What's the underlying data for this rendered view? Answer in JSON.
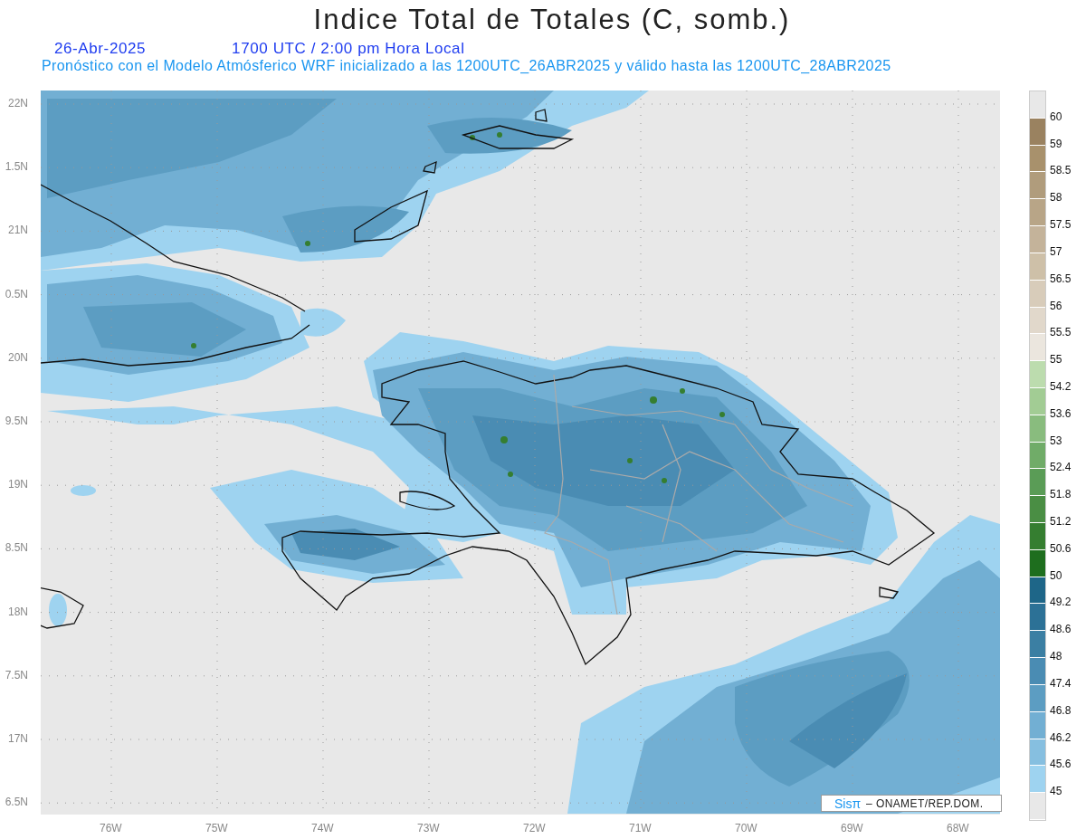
{
  "title": "Indice Total de Totales (C, somb.)",
  "date": "26-Abr-2025",
  "time": "1700 UTC / 2:00 pm Hora Local",
  "subtitle": "Pronóstico con el Modelo Atmósferico WRF inicializado a las 1200UTC_26ABR2025 y válido hasta las  1200UTC_28ABR2025",
  "map": {
    "lat_labels": [
      "22N",
      "1.5N",
      "21N",
      "0.5N",
      "20N",
      "9.5N",
      "19N",
      "8.5N",
      "18N",
      "7.5N",
      "17N",
      "6.5N"
    ],
    "lon_labels": [
      "76W",
      "75W",
      "74W",
      "73W",
      "72W",
      "71W",
      "70W",
      "69W",
      "68W"
    ]
  },
  "colorbar": {
    "cells": [
      {
        "color": "#e8e8e8"
      },
      {
        "color": "#9a8260"
      },
      {
        "color": "#a8916c"
      },
      {
        "color": "#b09c7c"
      },
      {
        "color": "#b8a587"
      },
      {
        "color": "#c4b39a"
      },
      {
        "color": "#cec0a8"
      },
      {
        "color": "#d8ccba"
      },
      {
        "color": "#e1d8cb"
      },
      {
        "color": "#ebe6de"
      },
      {
        "color": "#bcdcae"
      },
      {
        "color": "#a2cc94"
      },
      {
        "color": "#89bc7e"
      },
      {
        "color": "#70ac68"
      },
      {
        "color": "#5a9c56"
      },
      {
        "color": "#4a8e44"
      },
      {
        "color": "#357e30"
      },
      {
        "color": "#1e6e1e"
      },
      {
        "color": "#1e6688"
      },
      {
        "color": "#2c7196"
      },
      {
        "color": "#3b7fa3"
      },
      {
        "color": "#4a8cb3"
      },
      {
        "color": "#5c9dc2"
      },
      {
        "color": "#72afd3"
      },
      {
        "color": "#86bfe0"
      },
      {
        "color": "#9ed3f0"
      },
      {
        "color": "#e8e8e8"
      }
    ],
    "labels": [
      "60",
      "59",
      "58.5",
      "58",
      "57.5",
      "57",
      "56.5",
      "56",
      "55.5",
      "55",
      "54.2",
      "53.6",
      "53",
      "52.4",
      "51.8",
      "51.2",
      "50.6",
      "50",
      "49.2",
      "48.6",
      "48",
      "47.4",
      "46.8",
      "46.2",
      "45.6",
      "45"
    ]
  },
  "credit": {
    "brand": "Sisπ",
    "text": "– ONAMET/REP.DOM."
  }
}
